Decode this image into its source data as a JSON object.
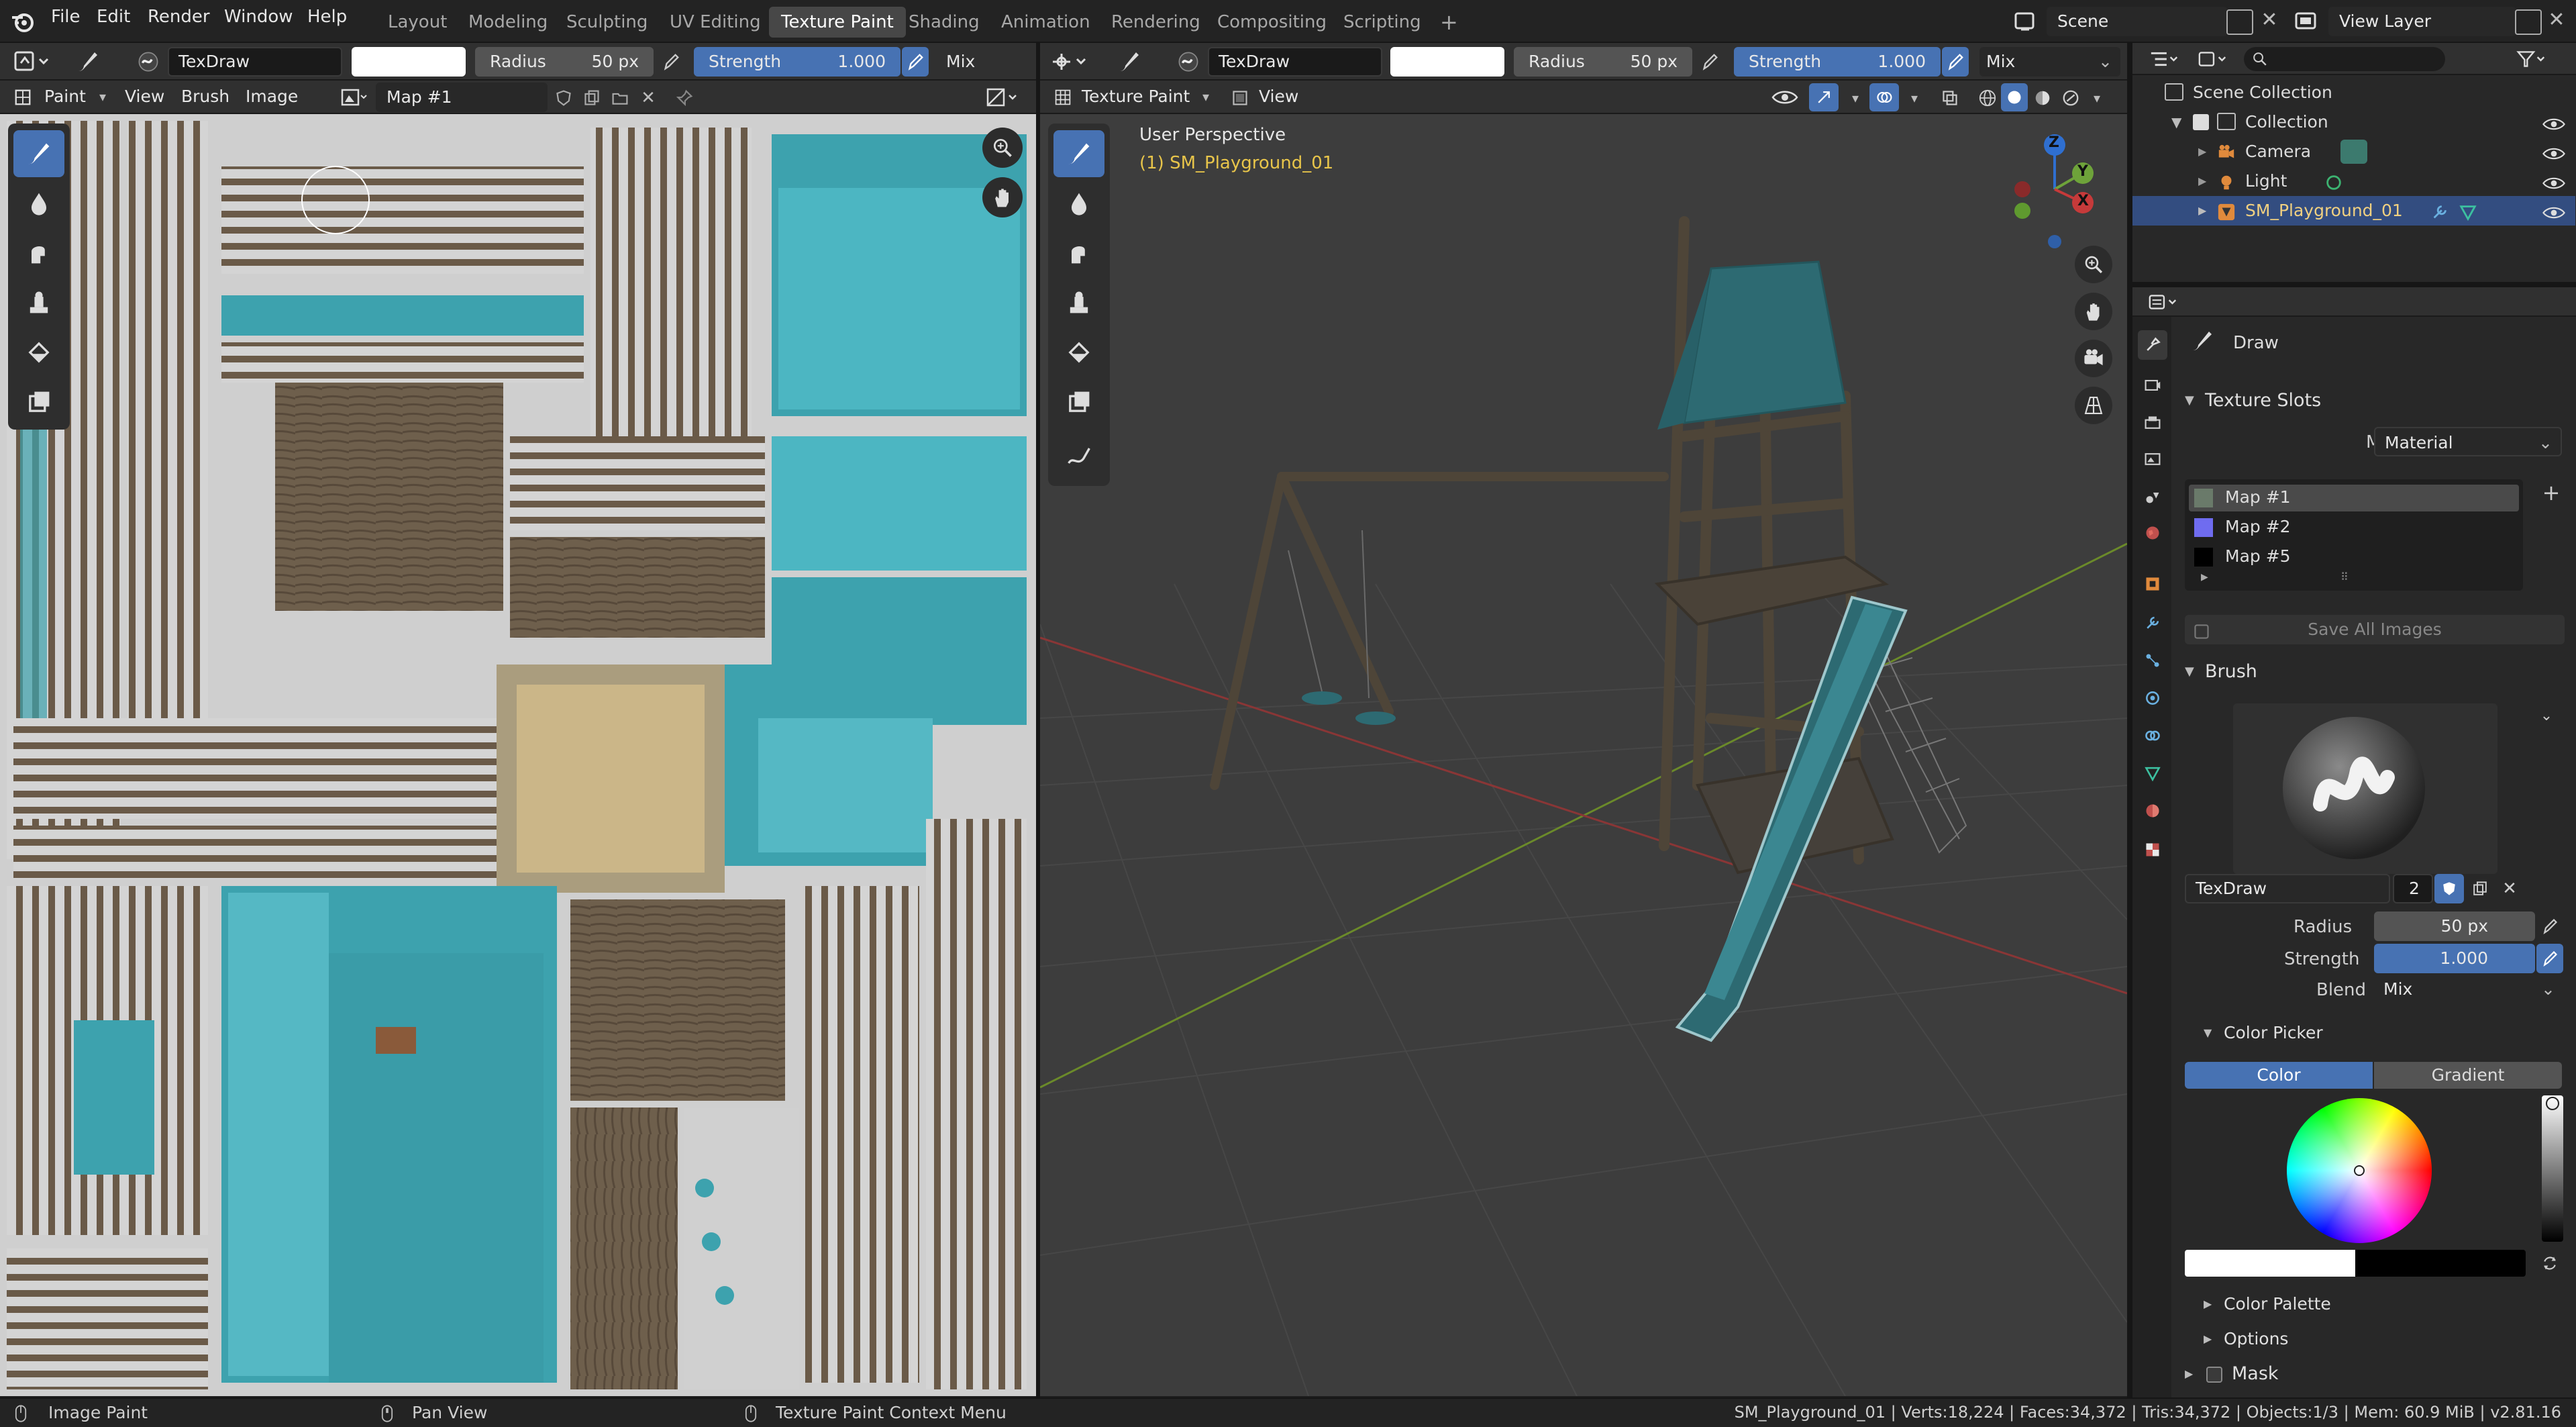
{
  "menu": {
    "file": "File",
    "edit": "Edit",
    "render": "Render",
    "window": "Window",
    "help": "Help"
  },
  "workspaces": [
    "Layout",
    "Modeling",
    "Sculpting",
    "UV Editing",
    "Texture Paint",
    "Shading",
    "Animation",
    "Rendering",
    "Compositing",
    "Scripting"
  ],
  "workspace_add": "+",
  "scene": {
    "name": "Scene",
    "view_layer": "View Layer"
  },
  "image_editor": {
    "brush_name": "TexDraw",
    "radius_label": "Radius",
    "radius_value": "50 px",
    "strength_label": "Strength",
    "strength_value": "1.000",
    "blend": "Mix",
    "mode": "Paint",
    "menus": [
      "View",
      "Brush",
      "Image"
    ],
    "image_name": "Map #1"
  },
  "viewport": {
    "brush_name": "TexDraw",
    "radius_label": "Radius",
    "radius_value": "50 px",
    "strength_label": "Strength",
    "strength_value": "1.000",
    "blend": "Mix",
    "mode": "Texture Paint",
    "view_menu": "View",
    "perspective": "User Perspective",
    "object_label": "(1) SM_Playground_01",
    "gizmo": {
      "x": "X",
      "y": "Y",
      "z": "Z"
    }
  },
  "outliner": {
    "root": "Scene Collection",
    "items": [
      {
        "label": "Collection"
      },
      {
        "label": "Camera"
      },
      {
        "label": "Light"
      },
      {
        "label": "SM_Playground_01"
      }
    ]
  },
  "properties": {
    "tool_name": "Draw",
    "texture_slots": {
      "title": "Texture Slots",
      "mode_label": "Mode",
      "mode_value": "Material",
      "slots": [
        {
          "name": "Map #1",
          "color": "#6a7a6a"
        },
        {
          "name": "Map #2",
          "color": "#6f6cf0"
        },
        {
          "name": "Map #5",
          "color": "#000000"
        }
      ],
      "save_all": "Save All Images"
    },
    "brush": {
      "title": "Brush",
      "name": "TexDraw",
      "users": "2",
      "radius_label": "Radius",
      "radius_value": "50 px",
      "strength_label": "Strength",
      "strength_value": "1.000",
      "blend_label": "Blend",
      "blend_value": "Mix"
    },
    "color_picker": {
      "title": "Color Picker",
      "tab_color": "Color",
      "tab_gradient": "Gradient"
    },
    "color_palette": "Color Palette",
    "options": "Options",
    "mask": "Mask"
  },
  "status": {
    "left": "Image Paint",
    "middle": "Pan View",
    "right": "Texture Paint Context Menu",
    "stats": "SM_Playground_01 | Verts:18,224 | Faces:34,372 | Tris:34,372 | Objects:1/3 | Mem: 60.9 MiB | v2.81.16"
  },
  "colors": {
    "accent": "#4772b3",
    "teal": "#3da2ae",
    "wood": "#6b5b48",
    "selected_object": "#e8c54a"
  }
}
